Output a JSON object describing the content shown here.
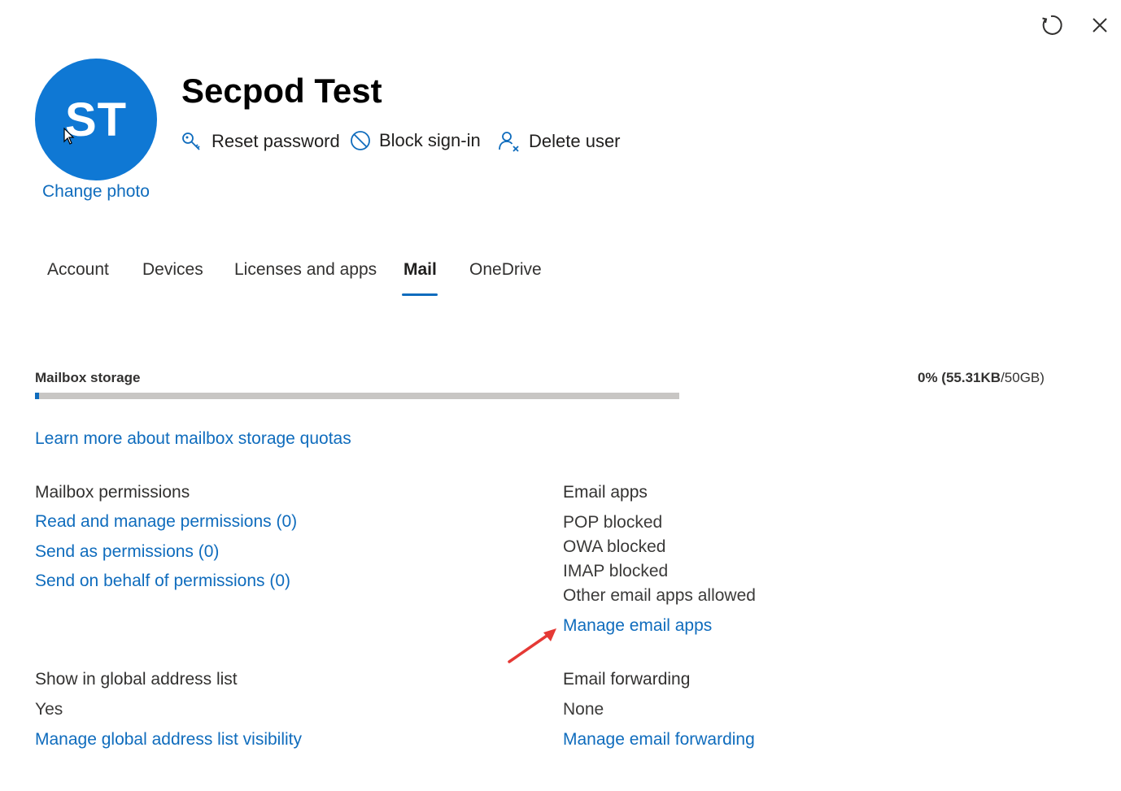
{
  "window": {
    "refresh_icon": "refresh-icon",
    "close_icon": "close-icon"
  },
  "user": {
    "initials": "ST",
    "name": "Secpod Test",
    "change_photo": "Change photo"
  },
  "actions": [
    {
      "label": "Reset password",
      "icon": "key-icon"
    },
    {
      "label": "Block sign-in",
      "icon": "block-icon"
    },
    {
      "label": "Delete user",
      "icon": "delete-user-icon"
    }
  ],
  "tabs": [
    {
      "label": "Account"
    },
    {
      "label": "Devices"
    },
    {
      "label": "Licenses and apps"
    },
    {
      "label": "Mail"
    },
    {
      "label": "OneDrive"
    }
  ],
  "active_tab": "Mail",
  "mailbox_storage": {
    "label": "Mailbox storage",
    "percent_text": "0% (55.31KB",
    "total_text": "/50GB)",
    "used_fraction": 0.01,
    "learn_more": "Learn more about mailbox storage quotas"
  },
  "mailbox_permissions": {
    "heading": "Mailbox permissions",
    "links": [
      "Read and manage permissions (0)",
      "Send as permissions (0)",
      "Send on behalf of permissions (0)"
    ]
  },
  "email_apps": {
    "heading": "Email apps",
    "items": [
      "POP blocked",
      "OWA blocked",
      "IMAP blocked",
      "Other email apps allowed"
    ],
    "manage": "Manage email apps"
  },
  "global_address_list": {
    "heading": "Show in global address list",
    "value": "Yes",
    "manage": "Manage global address list visibility"
  },
  "email_forwarding": {
    "heading": "Email forwarding",
    "value": "None",
    "manage": "Manage email forwarding"
  },
  "colors": {
    "accent": "#0f6cbd",
    "avatar": "#0f78d4",
    "annotation_arrow": "#e53935"
  }
}
